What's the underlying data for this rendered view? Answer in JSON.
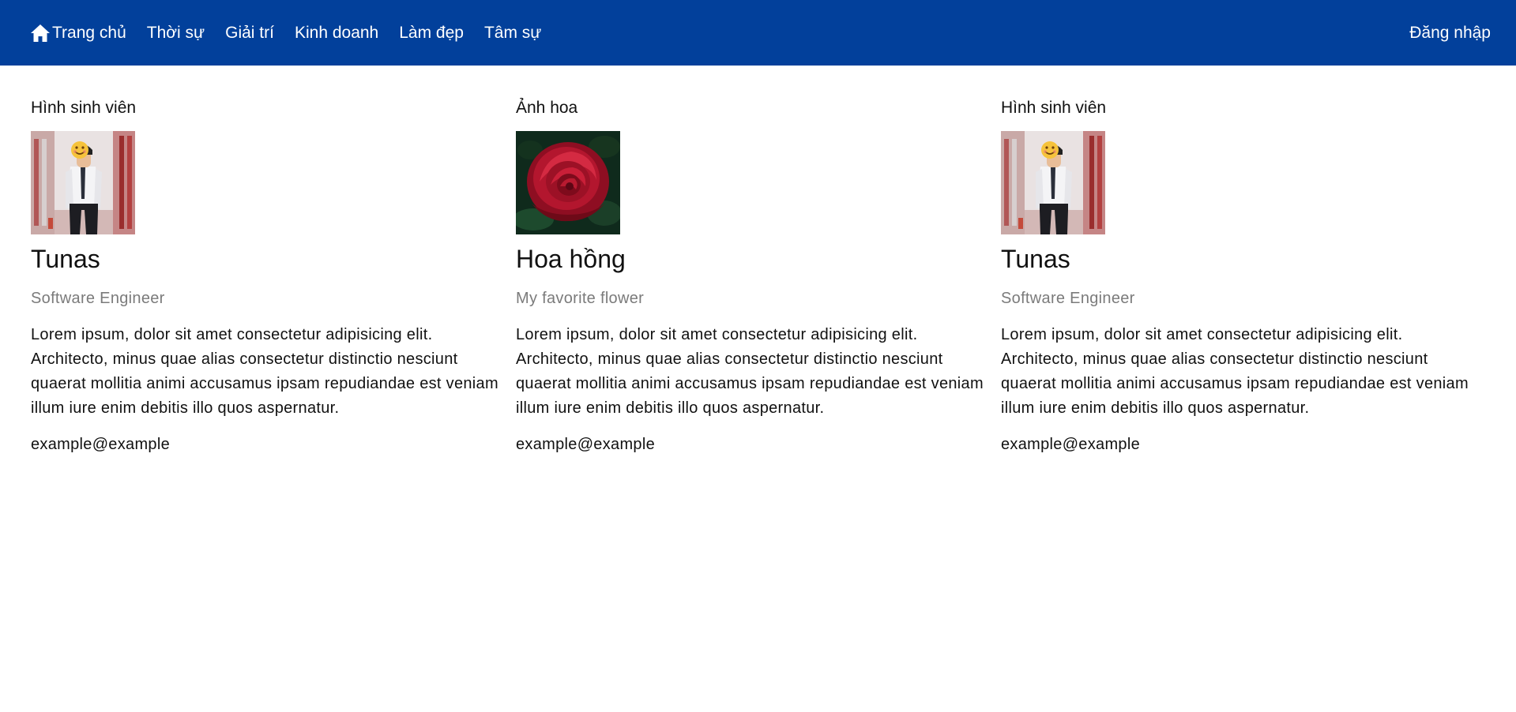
{
  "nav": {
    "items": [
      {
        "label": "Trang chủ",
        "icon": "home-icon"
      },
      {
        "label": "Thời sự"
      },
      {
        "label": "Giải trí"
      },
      {
        "label": "Kinh doanh"
      },
      {
        "label": "Làm đẹp"
      },
      {
        "label": "Tâm sự"
      }
    ],
    "login_label": "Đăng nhập",
    "background": "#02409b"
  },
  "cards": [
    {
      "caption": "Hình sinh viên",
      "image": "student-photo",
      "name": "Tunas",
      "subtitle": "Software Engineer",
      "body": "Lorem ipsum, dolor sit amet consectetur adipisicing elit. Architecto, minus quae alias consectetur distinctio nesciunt quaerat mollitia animi accusamus ipsam repudiandae est veniam illum iure enim debitis illo quos aspernatur.",
      "email": "example@example"
    },
    {
      "caption": "Ảnh hoa",
      "image": "rose-photo",
      "name": "Hoa hồng",
      "subtitle": "My favorite flower",
      "body": "Lorem ipsum, dolor sit amet consectetur adipisicing elit. Architecto, minus quae alias consectetur distinctio nesciunt quaerat mollitia animi accusamus ipsam repudiandae est veniam illum iure enim debitis illo quos aspernatur.",
      "email": "example@example"
    },
    {
      "caption": "Hình sinh viên",
      "image": "student-photo",
      "name": "Tunas",
      "subtitle": "Software Engineer",
      "body": "Lorem ipsum, dolor sit amet consectetur adipisicing elit. Architecto, minus quae alias consectetur distinctio nesciunt quaerat mollitia animi accusamus ipsam repudiandae est veniam illum iure enim debitis illo quos aspernatur.",
      "email": "example@example"
    }
  ]
}
